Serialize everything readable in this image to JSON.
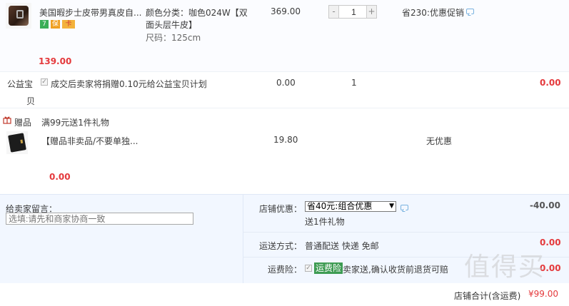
{
  "item1": {
    "title": "美国暇步士皮带男真皮自...",
    "sku_color": "颜色分类：咖色024W【双",
    "sku_color2": "面头层牛皮】",
    "sku_size": "尺码：125cm",
    "orig_price": "369.00",
    "quantity": "1",
    "qty_minus": "-",
    "qty_plus": "+",
    "promo": "省230:优惠促销",
    "sub_price": "139.00",
    "badges": [
      "7",
      "保",
      "卡"
    ]
  },
  "charity": {
    "label": "公益宝",
    "label2": "贝",
    "text": "成交后卖家将捐赠0.10元给公益宝贝计划",
    "price": "0.00",
    "qty": "1",
    "total": "0.00"
  },
  "gift": {
    "header_label": "赠品",
    "header_text": "满99元送1件礼物",
    "title": "【赠品非卖品/不要单独...",
    "price": "19.80",
    "promo": "无优惠",
    "sub_price": "0.00"
  },
  "message": {
    "label": "给卖家留言：",
    "placeholder": "选填:请先和商家协商一致"
  },
  "store_discount": {
    "label": "店铺优惠：",
    "selected": "省40元:组合优惠",
    "note": "送1件礼物",
    "amount": "-40.00"
  },
  "shipping": {
    "label": "运送方式：",
    "value": "普通配送 快递 免邮",
    "amount": "0.00"
  },
  "insurance": {
    "label": "运费险：",
    "tag": "运费险",
    "text": "卖家送,确认收货前退货可赔",
    "amount": "0.00"
  },
  "total": {
    "label": "店铺合计(含运费)",
    "amount": "¥99.00"
  },
  "watermark": "值得买",
  "colors": {
    "price_red": "#e4393c",
    "panel_bg": "#f2f7ff",
    "tag_green": "#3d9b52"
  }
}
